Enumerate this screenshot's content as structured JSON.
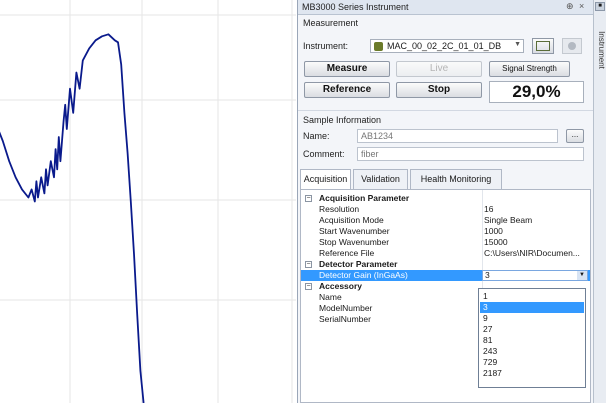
{
  "window": {
    "title": "MB3000 Series Instrument",
    "pin_glyph": "⊕",
    "close_glyph": "×"
  },
  "sidetab": {
    "label": "Instrument"
  },
  "measurement": {
    "group_label": "Measurement",
    "instrument_label": "Instrument:",
    "instrument_value": "MAC_00_02_2C_01_01_DB",
    "measure": "Measure",
    "live": "Live",
    "signal_strength": "Signal Strength",
    "reference": "Reference",
    "stop": "Stop",
    "signal_value": "29,0%"
  },
  "sample": {
    "group_label": "Sample Information",
    "name_label": "Name:",
    "name_value": "AB1234",
    "comment_label": "Comment:",
    "comment_value": "fiber",
    "browse": "..."
  },
  "tabs": [
    {
      "label": "Acquisition"
    },
    {
      "label": "Validation"
    },
    {
      "label": "Health Monitoring"
    }
  ],
  "grid": {
    "toggle_glyph": "−",
    "acq_category": "Acquisition Parameter",
    "resolution_name": "Resolution",
    "resolution_value": "16",
    "mode_name": "Acquisition Mode",
    "mode_value": "Single Beam",
    "start_name": "Start Wavenumber",
    "start_value": "1000",
    "stop_name": "Stop Wavenumber",
    "stop_value": "15000",
    "ref_name": "Reference File",
    "ref_value": "C:\\Users\\NIR\\Documen...",
    "det_category": "Detector Parameter",
    "gain_name": "Detector Gain (InGaAs)",
    "gain_value": "3",
    "acc_category": "Accessory",
    "acc_name": "Name",
    "acc_model": "ModelNumber",
    "acc_serial": "SerialNumber"
  },
  "gain_options": [
    "1",
    "3",
    "9",
    "27",
    "81",
    "243",
    "729",
    "2187"
  ],
  "gain_selected": "3",
  "colors": {
    "accent": "#3399ff",
    "spectrum_line": "#0a1a8c",
    "panel_bg": "#f3f5f9"
  },
  "spectrum_points": [
    [
      0,
      0.27
    ],
    [
      0.02,
      0.31
    ],
    [
      0.04,
      0.35
    ],
    [
      0.06,
      0.4
    ],
    [
      0.08,
      0.44
    ],
    [
      0.1,
      0.47
    ],
    [
      0.12,
      0.49
    ],
    [
      0.13,
      0.47
    ],
    [
      0.14,
      0.5
    ],
    [
      0.145,
      0.45
    ],
    [
      0.15,
      0.49
    ],
    [
      0.16,
      0.44
    ],
    [
      0.17,
      0.48
    ],
    [
      0.175,
      0.42
    ],
    [
      0.18,
      0.46
    ],
    [
      0.19,
      0.4
    ],
    [
      0.2,
      0.44
    ],
    [
      0.205,
      0.37
    ],
    [
      0.21,
      0.42
    ],
    [
      0.215,
      0.34
    ],
    [
      0.22,
      0.4
    ],
    [
      0.23,
      0.3
    ],
    [
      0.235,
      0.26
    ],
    [
      0.24,
      0.32
    ],
    [
      0.25,
      0.22
    ],
    [
      0.26,
      0.28
    ],
    [
      0.27,
      0.18
    ],
    [
      0.28,
      0.22
    ],
    [
      0.29,
      0.15
    ],
    [
      0.31,
      0.12
    ],
    [
      0.33,
      0.1
    ],
    [
      0.35,
      0.09
    ],
    [
      0.37,
      0.085
    ],
    [
      0.39,
      0.1
    ],
    [
      0.4,
      0.105
    ],
    [
      0.41,
      0.16
    ],
    [
      0.415,
      0.22
    ],
    [
      0.42,
      0.28
    ],
    [
      0.43,
      0.38
    ],
    [
      0.44,
      0.5
    ],
    [
      0.45,
      0.63
    ],
    [
      0.46,
      0.78
    ],
    [
      0.47,
      0.92
    ],
    [
      0.48,
      1.0
    ]
  ]
}
